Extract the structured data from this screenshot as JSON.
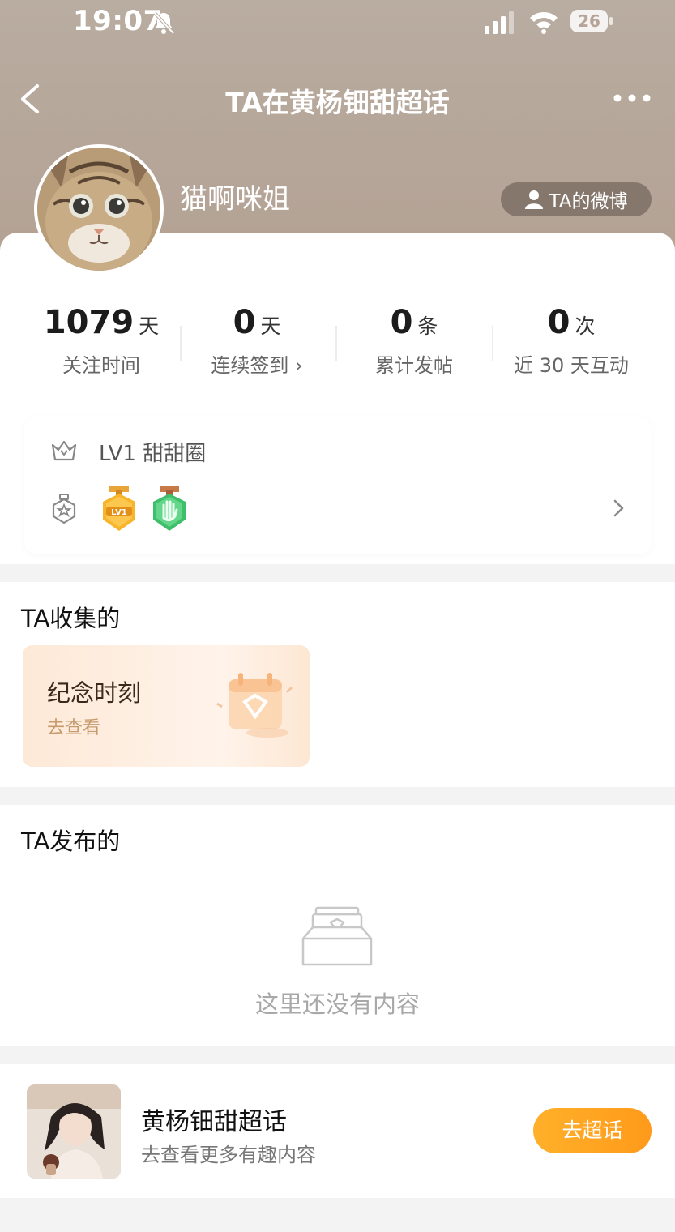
{
  "status_bar": {
    "time": "19:07",
    "battery": "26"
  },
  "nav": {
    "title": "TA在黄杨钿甜超话"
  },
  "profile": {
    "username": "猫啊咪姐",
    "weibo_button": "TA的微博"
  },
  "stats": [
    {
      "value": "1079",
      "unit": "天",
      "label": "关注时间"
    },
    {
      "value": "0",
      "unit": "天",
      "label": "连续签到 ›"
    },
    {
      "value": "0",
      "unit": "条",
      "label": "累计发帖"
    },
    {
      "value": "0",
      "unit": "次",
      "label": "近 30 天互动"
    }
  ],
  "level": {
    "text": "LV1 甜甜圈",
    "medal_1_text": "LV1"
  },
  "collected": {
    "title": "TA收集的",
    "card_title": "纪念时刻",
    "card_sub": "去查看"
  },
  "posted": {
    "title": "TA发布的",
    "empty_text": "这里还没有内容"
  },
  "topic": {
    "name": "黄杨钿甜超话",
    "subtitle": "去查看更多有趣内容",
    "button": "去超话"
  },
  "colors": {
    "accent": "#ff9f1c",
    "hero": "#b6a69a"
  }
}
